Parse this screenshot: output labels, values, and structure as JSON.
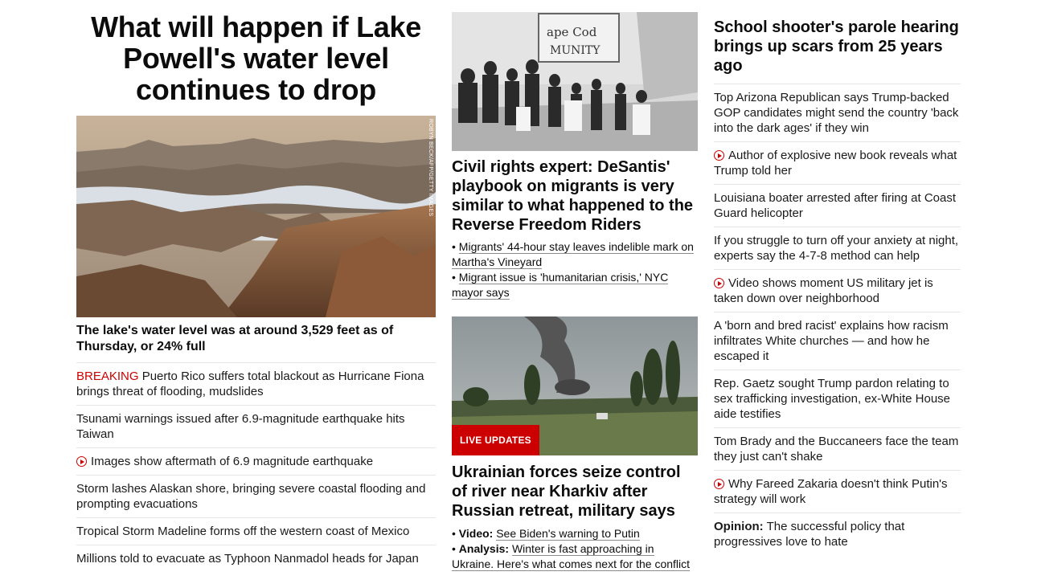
{
  "col1": {
    "headline": "What will happen if Lake Powell's water level continues to drop",
    "photo_credit": "ROBYN BECK/AFP/GETTY IMAGES",
    "caption": "The lake's water level was at around 3,529 feet as of Thursday, or 24% full",
    "items": [
      {
        "prefix": "BREAKING",
        "text": "Puerto Rico suffers total blackout as Hurricane Fiona brings threat of flooding, mudslides"
      },
      {
        "text": "Tsunami warnings issued after 6.9-magnitude earthquake hits Taiwan"
      },
      {
        "text": "Images show aftermath of 6.9 magnitude earthquake",
        "icon": "play-icon"
      },
      {
        "text": "Storm lashes Alaskan shore, bringing severe coastal flooding and prompting evacuations"
      },
      {
        "text": "Tropical Storm Madeline forms off the western coast of Mexico"
      },
      {
        "text": "Millions told to evacuate as Typhoon Nanmadol heads for Japan"
      }
    ]
  },
  "col2": {
    "card1": {
      "headline": "Civil rights expert: DeSantis' playbook on migrants is very similar to what happened to the Reverse Freedom Riders",
      "links": [
        {
          "text": "Migrants' 44-hour stay leaves indelible mark on Martha's Vineyard"
        },
        {
          "text": "Migrant issue is 'humanitarian crisis,' NYC mayor says"
        }
      ]
    },
    "card2": {
      "badge": "LIVE UPDATES",
      "headline": "Ukrainian forces seize control of river near Kharkiv after Russian retreat, military says",
      "links": [
        {
          "label": "Video:",
          "text": "See Biden's warning to Putin"
        },
        {
          "label": "Analysis:",
          "text": "Winter is fast approaching in Ukraine. Here's what comes next for the conflict"
        }
      ]
    }
  },
  "col3": {
    "headline": "School shooter's parole hearing brings up scars from 25 years ago",
    "items": [
      {
        "text": "Top Arizona Republican says Trump-backed GOP candidates might send the country 'back into the dark ages' if they win"
      },
      {
        "text": "Author of explosive new book reveals what Trump told her",
        "icon": "play-icon"
      },
      {
        "text": "Louisiana boater arrested after firing at Coast Guard helicopter"
      },
      {
        "text": "If you struggle to turn off your anxiety at night, experts say the 4-7-8 method can help"
      },
      {
        "text": "Video shows moment US military jet is taken down over neighborhood",
        "icon": "play-icon"
      },
      {
        "text": "A 'born and bred racist' explains how racism infiltrates White churches — and how he escaped it"
      },
      {
        "text": "Rep. Gaetz sought Trump pardon relating to sex trafficking investigation, ex-White House aide testifies"
      },
      {
        "text": "Tom Brady and the Buccaneers face the team they just can't shake"
      },
      {
        "text": "Why Fareed Zakaria doesn't think Putin's strategy will work",
        "icon": "play-icon"
      },
      {
        "prefix": "Opinion:",
        "text": "The successful policy that progressives love to hate"
      }
    ]
  },
  "colors": {
    "accent": "#cc0000",
    "text": "#0c0c0c",
    "divider": "#e6e6e6"
  }
}
